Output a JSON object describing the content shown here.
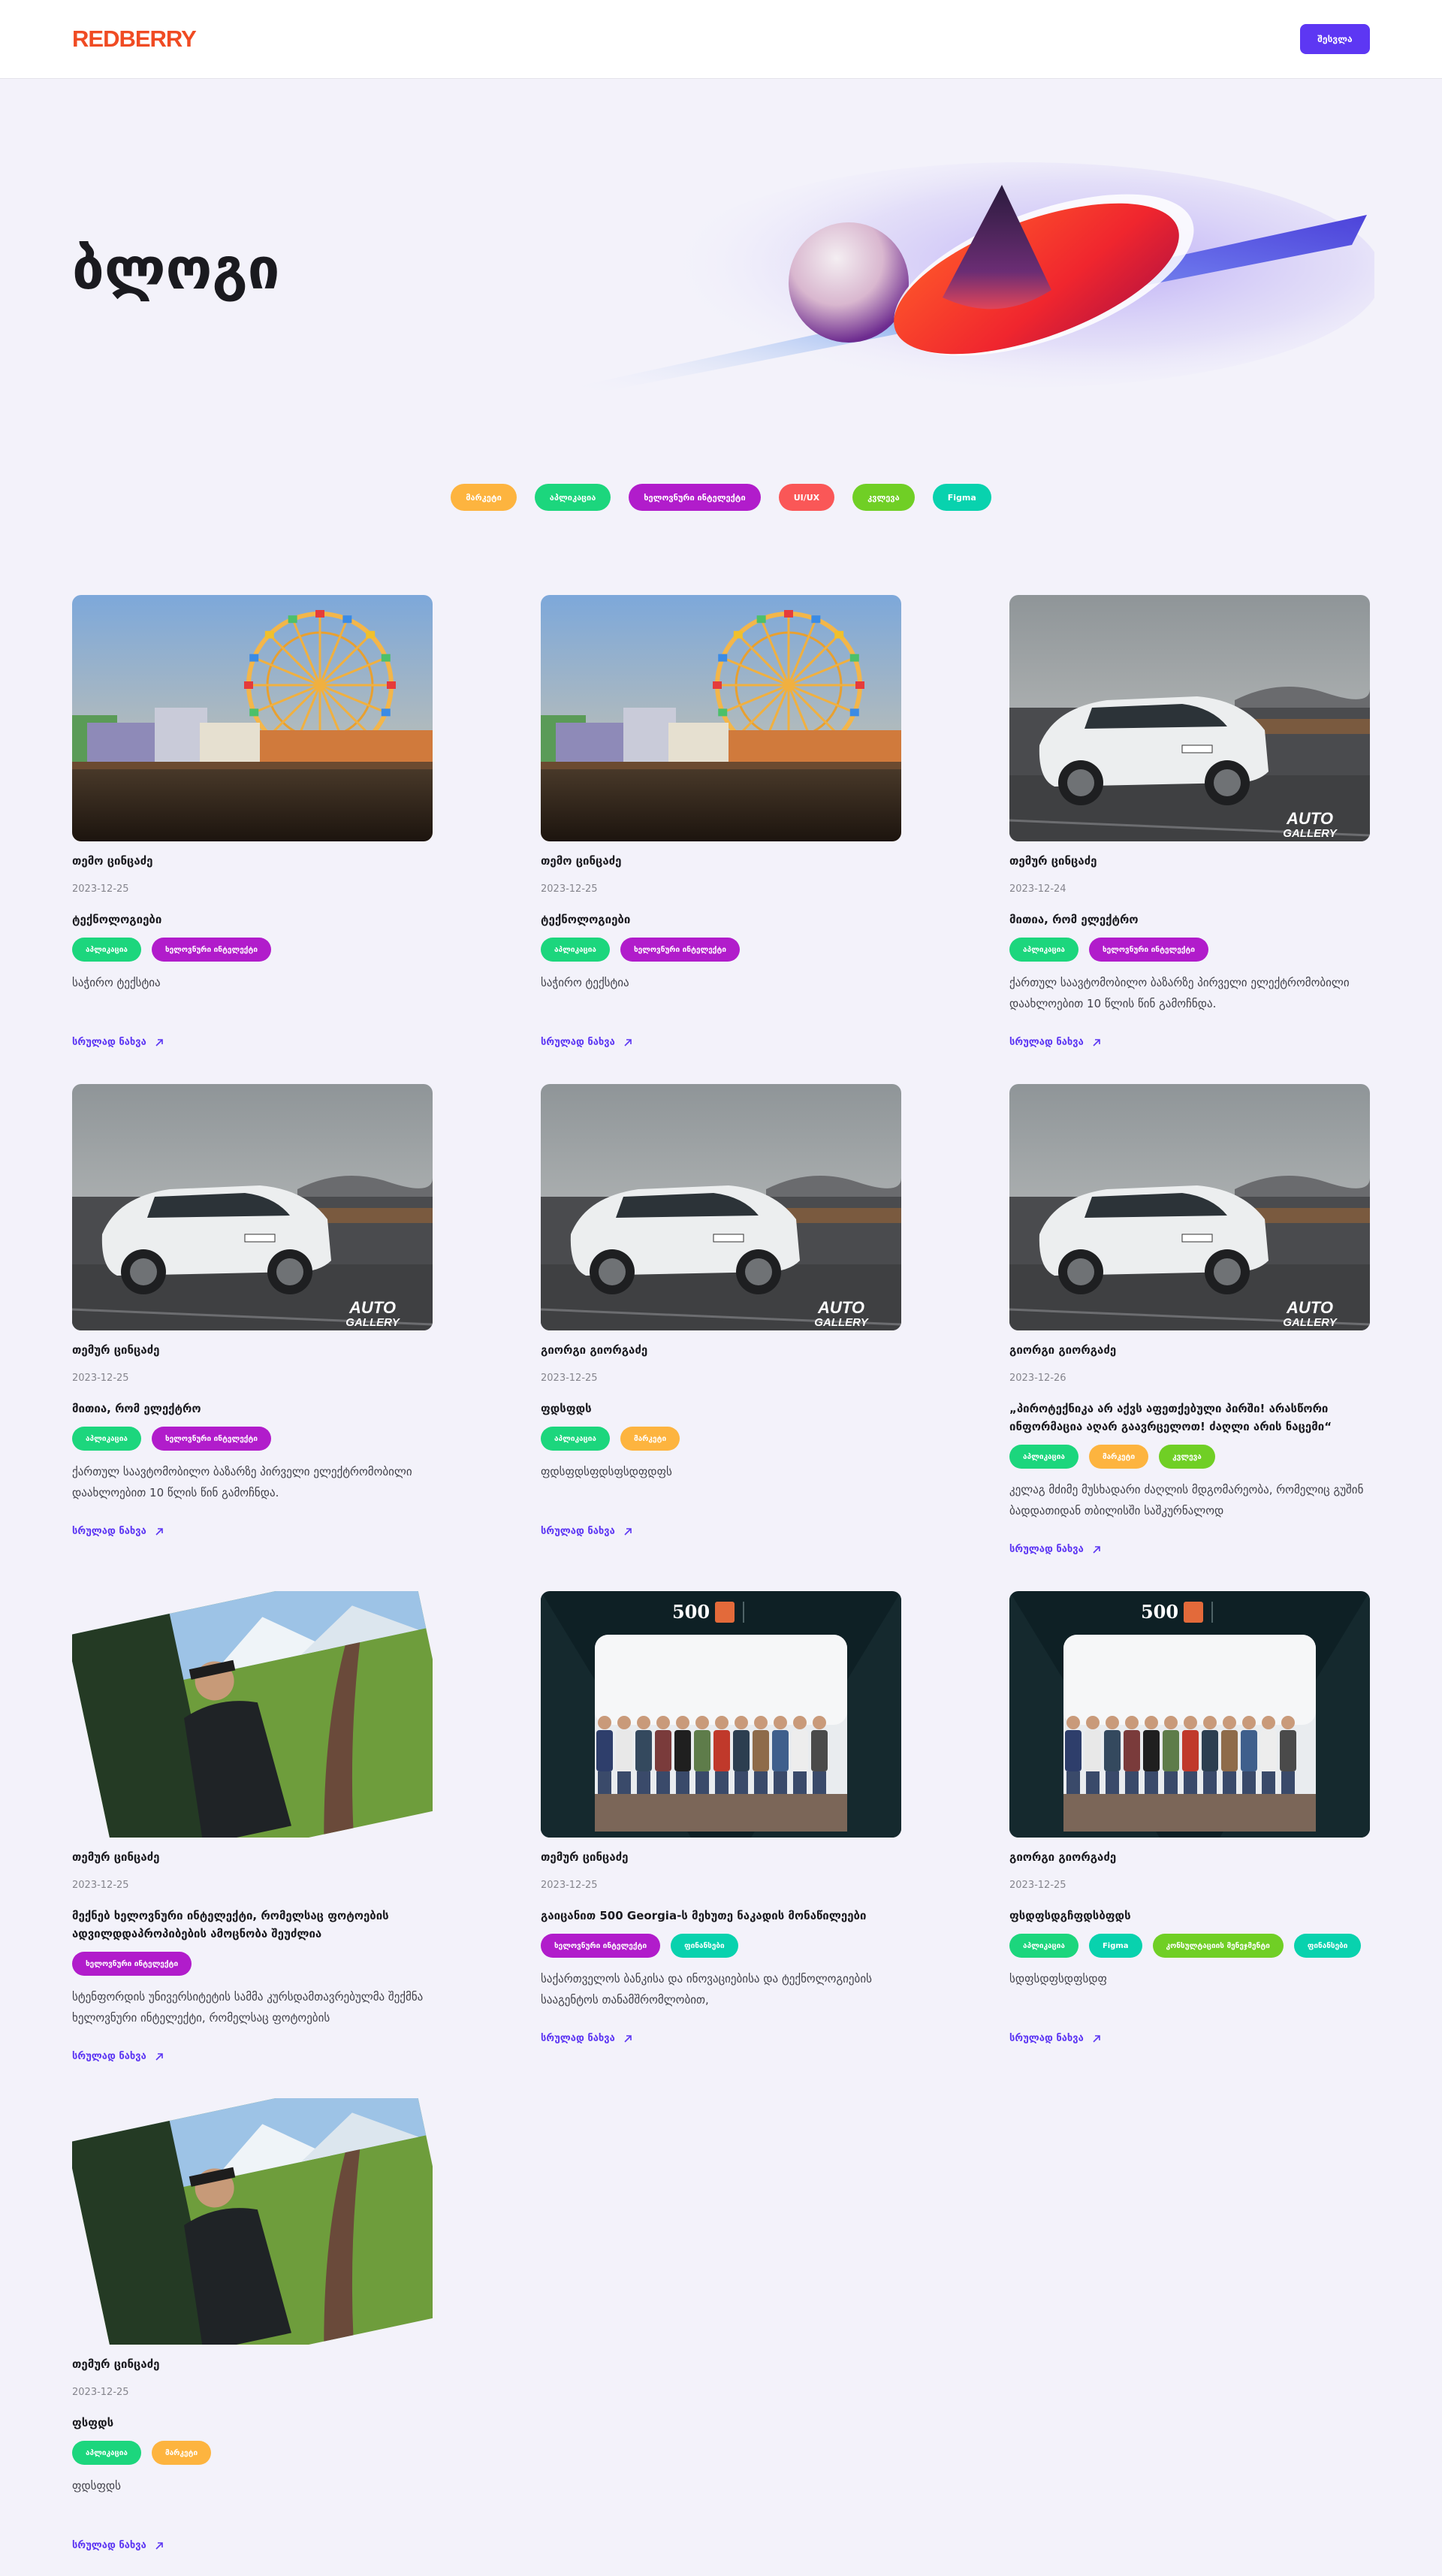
{
  "header": {
    "logo": "REDBERRY",
    "login_label": "შესვლა"
  },
  "page_title": "ბლოგი",
  "filters": [
    {
      "label": "მარკეტი",
      "bg": "#FDB43F",
      "fg": "#FFFFFF"
    },
    {
      "label": "აპლიკაცია",
      "bg": "#1CD67D",
      "fg": "#FFFFFF"
    },
    {
      "label": "ხელოვნური ინტელექტი",
      "bg": "#B11CCB",
      "fg": "#FFFFFF"
    },
    {
      "label": "UI/UX",
      "bg": "#FA5757",
      "fg": "#FFFFFF"
    },
    {
      "label": "კვლევა",
      "bg": "#70CF25",
      "fg": "#FFFFFF"
    },
    {
      "label": "Figma",
      "bg": "#08D2AE",
      "fg": "#FFFFFF"
    }
  ],
  "read_more_label": "სრულად ნახვა",
  "posts": [
    {
      "author": "თემო ცინცაძე",
      "date": "2023-12-25",
      "title": "ტექნოლოგიები",
      "tags": [
        {
          "label": "აპლიკაცია",
          "bg": "#1CD67D"
        },
        {
          "label": "ხელოვნური ინტელექტი",
          "bg": "#B11CCB"
        }
      ],
      "desc": "საჭირო ტექსტია",
      "image": "pier-ferris-wheel"
    },
    {
      "author": "თემო ცინცაძე",
      "date": "2023-12-25",
      "title": "ტექნოლოგიები",
      "tags": [
        {
          "label": "აპლიკაცია",
          "bg": "#1CD67D"
        },
        {
          "label": "ხელოვნური ინტელექტი",
          "bg": "#B11CCB"
        }
      ],
      "desc": "საჭირო ტექსტია",
      "image": "pier-ferris-wheel"
    },
    {
      "author": "თემურ ცინცაძე",
      "date": "2023-12-24",
      "title": "მითია, რომ ელექტრო",
      "tags": [
        {
          "label": "აპლიკაცია",
          "bg": "#1CD67D"
        },
        {
          "label": "ხელოვნური ინტელექტი",
          "bg": "#B11CCB"
        }
      ],
      "desc": "ქართულ საავტომობილო ბაზარზე პირველი ელექტრომობილი დაახლოებით 10 წლის წინ გამოჩნდა.",
      "image": "white-suv",
      "badge": "AUTO GALLERY"
    },
    {
      "author": "თემურ ცინცაძე",
      "date": "2023-12-25",
      "title": "მითია, რომ ელექტრო",
      "tags": [
        {
          "label": "აპლიკაცია",
          "bg": "#1CD67D"
        },
        {
          "label": "ხელოვნური ინტელექტი",
          "bg": "#B11CCB"
        }
      ],
      "desc": "ქართულ საავტომობილო ბაზარზე პირველი ელექტრომობილი დაახლოებით 10 წლის წინ გამოჩნდა.",
      "image": "white-suv",
      "badge": "AUTO GALLERY"
    },
    {
      "author": "გიორგი გიორგაძე",
      "date": "2023-12-25",
      "title": "ფდსფდს",
      "tags": [
        {
          "label": "აპლიკაცია",
          "bg": "#1CD67D"
        },
        {
          "label": "მარკეტი",
          "bg": "#FDB43F"
        }
      ],
      "desc": "ფდსფდსფდსფსდფდფს",
      "image": "white-suv",
      "badge": "AUTO GALLERY"
    },
    {
      "author": "გიორგი გიორგაძე",
      "date": "2023-12-26",
      "title": "„პიროტექნიკა არ აქვს აფეთქებული პირში! არასწორი ინფორმაცია აღარ გაავრცელოთ! ძაღლი არის ნაცემი“",
      "tags": [
        {
          "label": "აპლიკაცია",
          "bg": "#1CD67D"
        },
        {
          "label": "მარკეტი",
          "bg": "#FDB43F"
        },
        {
          "label": "კვლევა",
          "bg": "#70CF25"
        }
      ],
      "desc": "კელაგ მძიმე მუსხადარი ძაღლის მდგომარეობა, რომელიც გუშინ ბადდათიდან თბილისში საშკურნალოდ",
      "image": "white-suv",
      "badge": "AUTO GALLERY"
    },
    {
      "author": "თემურ ცინცაძე",
      "date": "2023-12-25",
      "title": "მექნებ ხელოვნური ინტელექტი, რომელსაც ფოტოების ადვილდდაპროპიბების ამოცნობა შეუძლია",
      "tags": [
        {
          "label": "ხელოვნური ინტელექტი",
          "bg": "#B11CCB"
        }
      ],
      "desc": "სტენფორდის უნივერსიტეტის სამმა კურსდამთავრებულმა შექმნა ხელოვნური ინტელექტი, რომელსაც ფოტოების",
      "image": "hiker"
    },
    {
      "author": "თემურ ცინცაძე",
      "date": "2023-12-25",
      "title": "გაიცანით 500 Georgia-ს მეხუთე ნაკადის მონაწილეები",
      "tags": [
        {
          "label": "ხელოვნური ინტელექტი",
          "bg": "#B11CCB"
        },
        {
          "label": "ფინანსები",
          "bg": "#08D2AE"
        }
      ],
      "desc": "საქართველოს ბანკისა და ინოვაციებისა და ტექნოლოგიების სააგენტოს თანამშრომლობით,",
      "image": "group-photo",
      "badge": "500"
    },
    {
      "author": "გიორგი გიორგაძე",
      "date": "2023-12-25",
      "title": "ფსდფსდგჩფდსბფდს",
      "tags": [
        {
          "label": "აპლიკაცია",
          "bg": "#1CD67D"
        },
        {
          "label": "Figma",
          "bg": "#08D2AE"
        },
        {
          "label": "კონსულტაციის მენეჯმენტი",
          "bg": "#70CF25"
        },
        {
          "label": "ფინანსები",
          "bg": "#08D2AE"
        }
      ],
      "desc": "სდფსდფსდფსდფ",
      "image": "group-photo",
      "badge": "500"
    },
    {
      "author": "თემურ ცინცაძე",
      "date": "2023-12-25",
      "title": "ფსფდს",
      "tags": [
        {
          "label": "აპლიკაცია",
          "bg": "#1CD67D"
        },
        {
          "label": "მარკეტი",
          "bg": "#FDB43F"
        }
      ],
      "desc": "ფდსფდს",
      "image": "hiker"
    }
  ]
}
